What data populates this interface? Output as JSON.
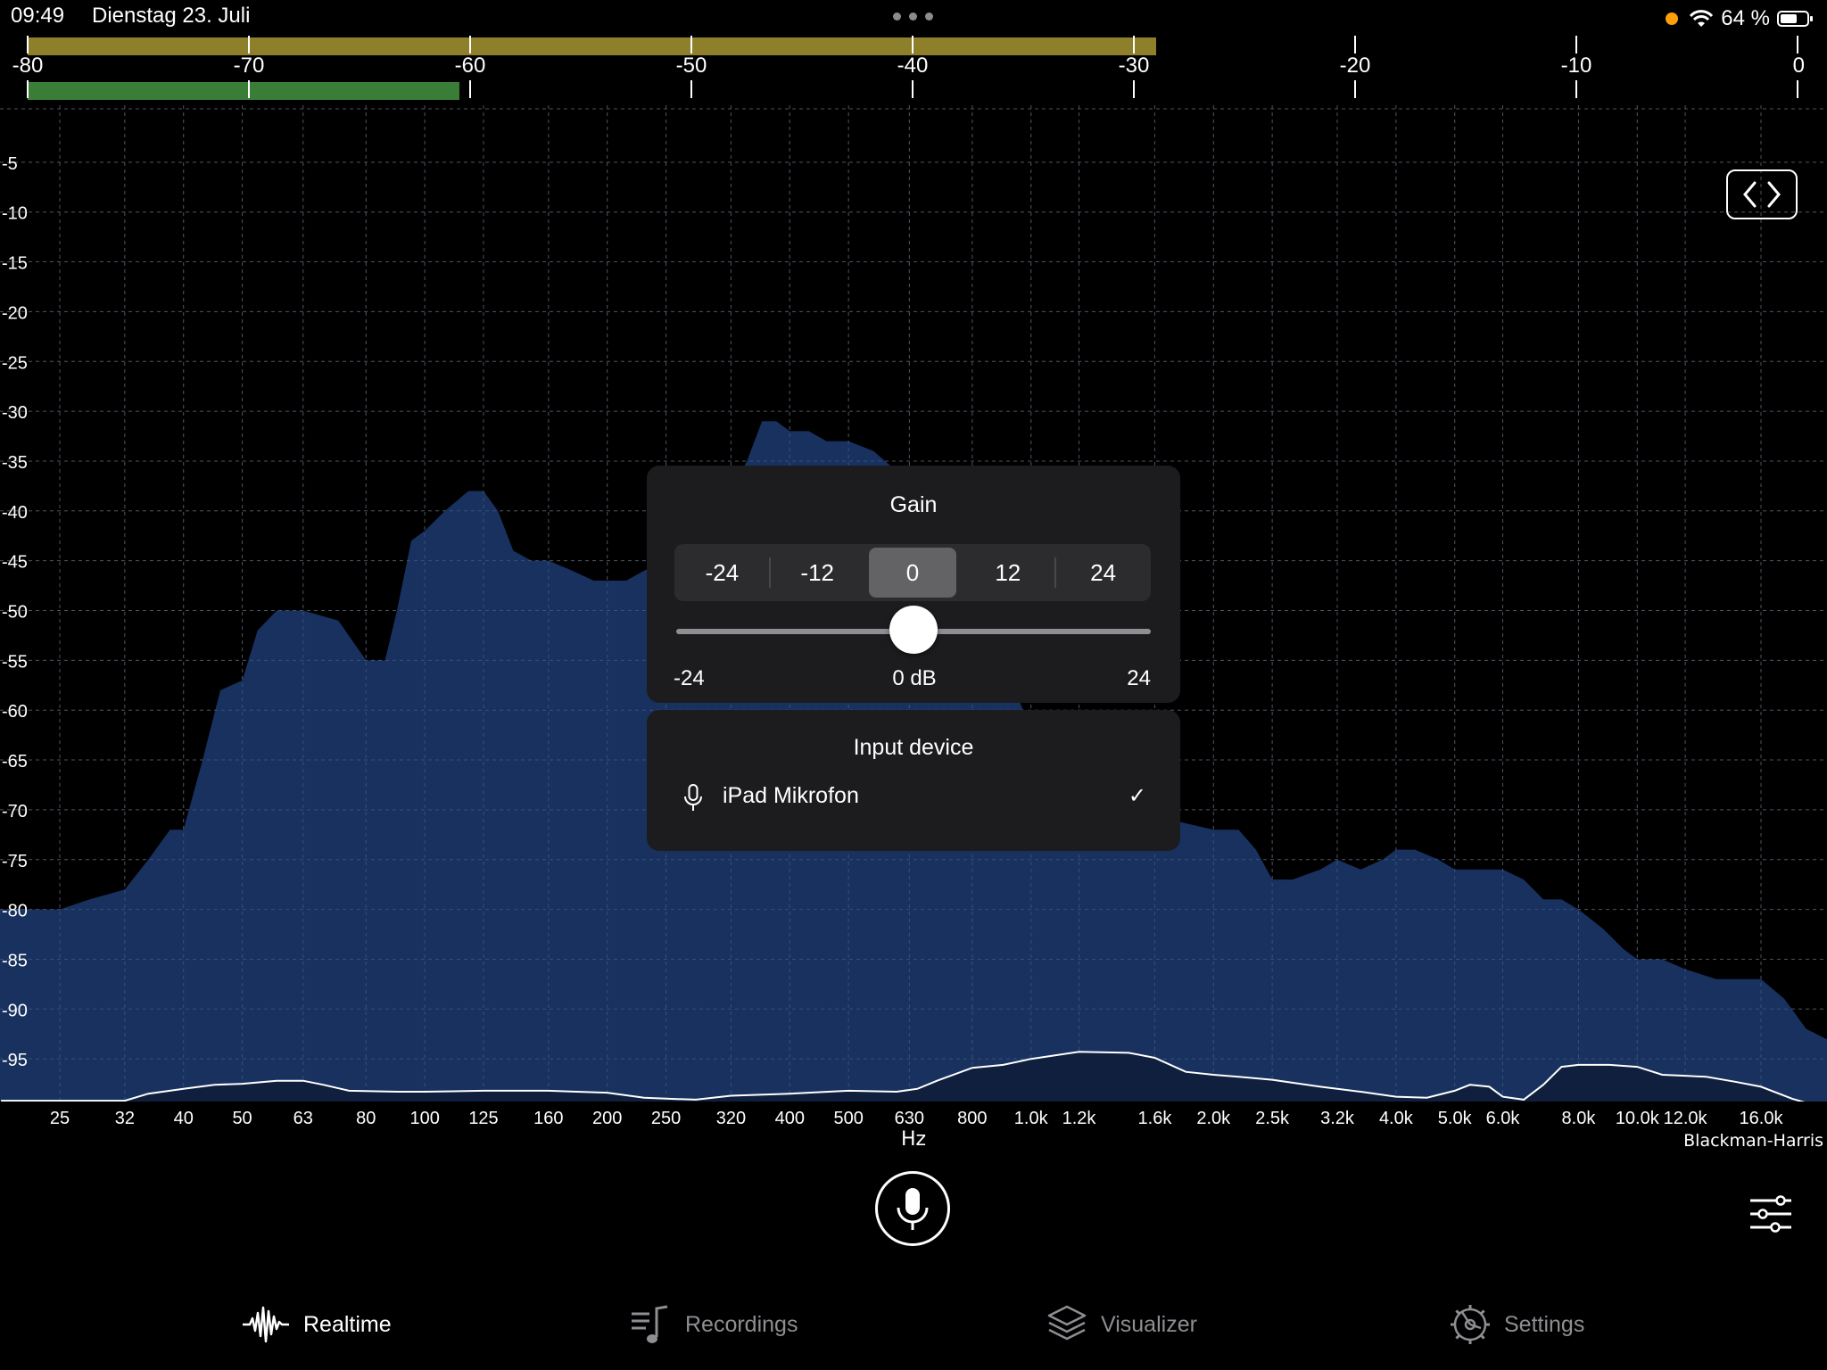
{
  "status_bar": {
    "time": "09:49",
    "date": "Dienstag 23. Juli",
    "battery": "64 %",
    "battery_level": 0.64
  },
  "level_meter": {
    "scale_labels": [
      "-80",
      "-70",
      "-60",
      "-50",
      "-40",
      "-30",
      "-20",
      "-10",
      "0"
    ],
    "peak_level_db": -29,
    "rms_level_db": -60.5,
    "peak_color": "#8e7f2a",
    "rms_color": "#3a7d37"
  },
  "chart_data": {
    "type": "area",
    "x_scale": "log",
    "xlim": [
      20,
      22000
    ],
    "ylim": [
      -100,
      0
    ],
    "grid": true,
    "xlabel": "Hz",
    "y_ticks": [
      "-5",
      "-10",
      "-15",
      "-20",
      "-25",
      "-30",
      "-35",
      "-40",
      "-45",
      "-50",
      "-55",
      "-60",
      "-65",
      "-70",
      "-75",
      "-80",
      "-85",
      "-90",
      "-95"
    ],
    "x_ticks": [
      "25",
      "32",
      "40",
      "50",
      "63",
      "80",
      "100",
      "125",
      "160",
      "200",
      "250",
      "320",
      "400",
      "500",
      "630",
      "800",
      "1.0k",
      "1.2k",
      "1.6k",
      "2.0k",
      "2.5k",
      "3.2k",
      "4.0k",
      "5.0k",
      "6.0k",
      "8.0k",
      "10.0k",
      "12.0k",
      "16.0k"
    ],
    "fill_color": "#1a3566",
    "series": [
      {
        "values": [
          [
            20,
            -80
          ],
          [
            25,
            -80
          ],
          [
            28,
            -79
          ],
          [
            32,
            -78
          ],
          [
            35,
            -75
          ],
          [
            38,
            -72
          ],
          [
            40,
            -72
          ],
          [
            43,
            -65
          ],
          [
            46,
            -58
          ],
          [
            50,
            -57
          ],
          [
            53,
            -52
          ],
          [
            57,
            -50
          ],
          [
            63,
            -50
          ],
          [
            72,
            -51
          ],
          [
            80,
            -55
          ],
          [
            86,
            -55
          ],
          [
            90,
            -50
          ],
          [
            95,
            -43
          ],
          [
            100,
            -42
          ],
          [
            108,
            -40
          ],
          [
            118,
            -38
          ],
          [
            125,
            -38
          ],
          [
            132,
            -40
          ],
          [
            140,
            -44
          ],
          [
            150,
            -45
          ],
          [
            160,
            -45
          ],
          [
            175,
            -46
          ],
          [
            190,
            -47
          ],
          [
            200,
            -47
          ],
          [
            215,
            -47
          ],
          [
            230,
            -46
          ],
          [
            250,
            -45
          ],
          [
            280,
            -42
          ],
          [
            320,
            -38
          ],
          [
            340,
            -35
          ],
          [
            360,
            -31
          ],
          [
            380,
            -31
          ],
          [
            400,
            -32
          ],
          [
            430,
            -32
          ],
          [
            460,
            -33
          ],
          [
            500,
            -33
          ],
          [
            550,
            -34
          ],
          [
            600,
            -36
          ],
          [
            630,
            -38
          ],
          [
            700,
            -42
          ],
          [
            800,
            -48
          ],
          [
            900,
            -55
          ],
          [
            1000,
            -62
          ],
          [
            1200,
            -67
          ],
          [
            1450,
            -70
          ],
          [
            1700,
            -71
          ],
          [
            2000,
            -72
          ],
          [
            2200,
            -72
          ],
          [
            2350,
            -74
          ],
          [
            2500,
            -77
          ],
          [
            2700,
            -77
          ],
          [
            3000,
            -76
          ],
          [
            3200,
            -75
          ],
          [
            3500,
            -76
          ],
          [
            3800,
            -75
          ],
          [
            4000,
            -74
          ],
          [
            4300,
            -74
          ],
          [
            4700,
            -75
          ],
          [
            5000,
            -76
          ],
          [
            5500,
            -76
          ],
          [
            6000,
            -76
          ],
          [
            6500,
            -77
          ],
          [
            7000,
            -79
          ],
          [
            7500,
            -79
          ],
          [
            8000,
            -80
          ],
          [
            8800,
            -82
          ],
          [
            9500,
            -84
          ],
          [
            10000,
            -85
          ],
          [
            11000,
            -85
          ],
          [
            12000,
            -86
          ],
          [
            13500,
            -87
          ],
          [
            16000,
            -87
          ],
          [
            17500,
            -89
          ],
          [
            19000,
            -92
          ],
          [
            20500,
            -93
          ]
        ]
      },
      {
        "values": [
          [
            20,
            -99.2
          ],
          [
            28,
            -99.2
          ],
          [
            32,
            -99.2
          ],
          [
            35,
            -98.5
          ],
          [
            40,
            -98
          ],
          [
            45,
            -97.6
          ],
          [
            50,
            -97.5
          ],
          [
            57,
            -97.2
          ],
          [
            63,
            -97.2
          ],
          [
            68,
            -97.6
          ],
          [
            75,
            -98.2
          ],
          [
            90,
            -98.3
          ],
          [
            100,
            -98.3
          ],
          [
            125,
            -98.2
          ],
          [
            160,
            -98.2
          ],
          [
            200,
            -98.4
          ],
          [
            230,
            -98.9
          ],
          [
            250,
            -99.0
          ],
          [
            280,
            -99.1
          ],
          [
            320,
            -98.7
          ],
          [
            400,
            -98.5
          ],
          [
            500,
            -98.2
          ],
          [
            600,
            -98.3
          ],
          [
            650,
            -98.0
          ],
          [
            700,
            -97.2
          ],
          [
            800,
            -95.9
          ],
          [
            900,
            -95.6
          ],
          [
            1000,
            -95.0
          ],
          [
            1200,
            -94.3
          ],
          [
            1450,
            -94.4
          ],
          [
            1600,
            -94.9
          ],
          [
            1800,
            -96.3
          ],
          [
            2000,
            -96.6
          ],
          [
            2200,
            -96.8
          ],
          [
            2500,
            -97.1
          ],
          [
            3000,
            -97.8
          ],
          [
            3500,
            -98.3
          ],
          [
            4000,
            -98.8
          ],
          [
            4500,
            -98.9
          ],
          [
            5000,
            -98.2
          ],
          [
            5300,
            -97.6
          ],
          [
            5700,
            -97.8
          ],
          [
            6000,
            -98.8
          ],
          [
            6500,
            -99.1
          ],
          [
            7000,
            -97.6
          ],
          [
            7500,
            -95.8
          ],
          [
            8000,
            -95.6
          ],
          [
            9000,
            -95.6
          ],
          [
            10000,
            -95.8
          ],
          [
            11000,
            -96.6
          ],
          [
            12000,
            -96.7
          ],
          [
            13000,
            -96.8
          ],
          [
            14500,
            -97.3
          ],
          [
            16000,
            -97.8
          ],
          [
            18000,
            -99.0
          ],
          [
            20500,
            -100
          ]
        ]
      }
    ]
  },
  "window_function": "Blackman-Harris",
  "gain_panel": {
    "title": "Gain",
    "options": [
      "-24",
      "-12",
      "0",
      "12",
      "24"
    ],
    "selected": "0",
    "slider_min_label": "-24",
    "slider_max_label": "24",
    "slider_value_label": "0 dB",
    "slider_value": 0,
    "slider_min": -24,
    "slider_max": 24
  },
  "input_panel": {
    "title": "Input device",
    "device_name": "iPad Mikrofon",
    "device_selected": true
  },
  "tabs": [
    {
      "label": "Realtime",
      "icon": "waveform-icon",
      "active": true
    },
    {
      "label": "Recordings",
      "icon": "music-list-icon",
      "active": false
    },
    {
      "label": "Visualizer",
      "icon": "layers-icon",
      "active": false
    },
    {
      "label": "Settings",
      "icon": "gear-icon",
      "active": false
    }
  ]
}
